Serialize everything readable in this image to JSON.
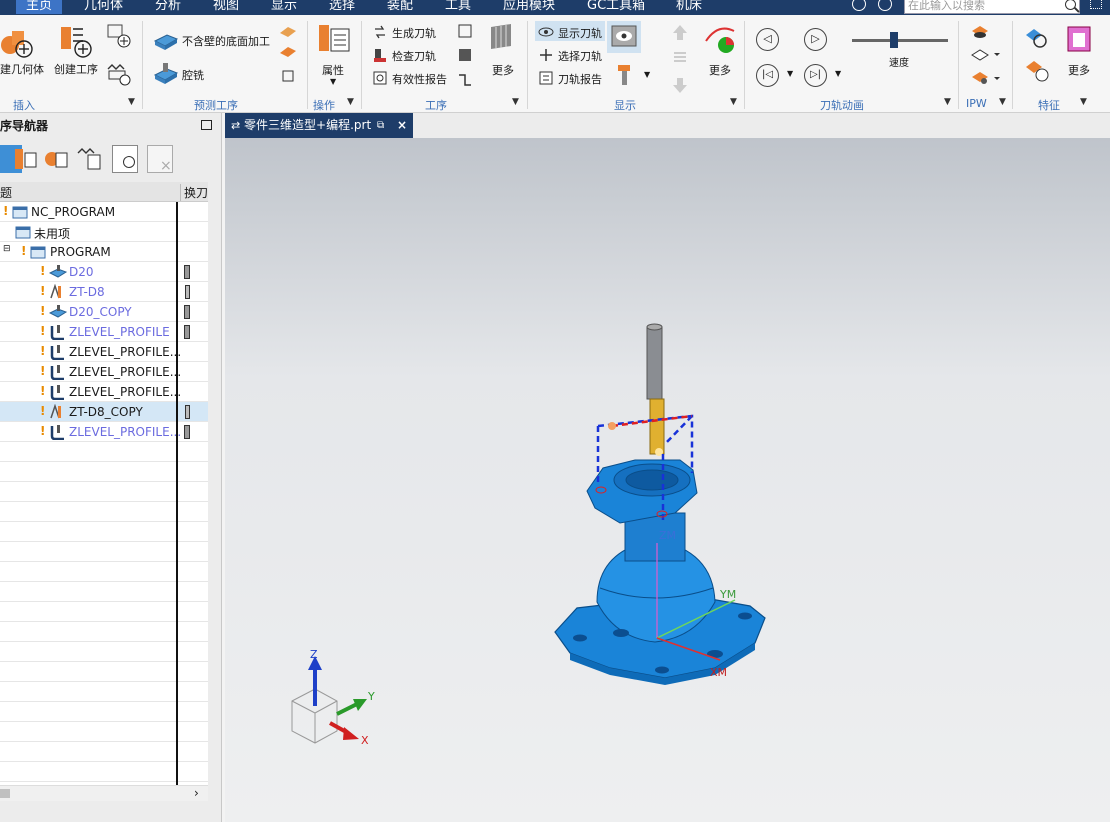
{
  "menubar": {
    "items": [
      "主页",
      "几何体",
      "分析",
      "视图",
      "显示",
      "选择",
      "装配",
      "工具",
      "应用模块",
      "GC工具箱",
      "机床"
    ],
    "search_placeholder": "在此输入以搜索"
  },
  "ribbon": {
    "insert": {
      "create_geometry": "建几何体",
      "create_operation": "创建工序",
      "label": "插入"
    },
    "predefined": {
      "floor_wall": "不含壁的底面加工",
      "cavity": "腔铣",
      "label": "预测工序"
    },
    "operation": {
      "properties": "属性",
      "label": "操作"
    },
    "process": {
      "generate": "生成刀轨",
      "verify": "检查刀轨",
      "report": "有效性报告",
      "more": "更多",
      "label": "工序"
    },
    "display": {
      "show_path": "显示刀轨",
      "select_path": "选择刀轨",
      "path_report": "刀轨报告",
      "more": "更多",
      "label": "显示"
    },
    "animation": {
      "speed": "速度",
      "label": "刀轨动画"
    },
    "ipw": {
      "label": "IPW"
    },
    "feature": {
      "more": "更多",
      "label": "特征"
    }
  },
  "navigator": {
    "title": "序导航器",
    "col_name": "题",
    "col_tool_change": "换刀",
    "rows": [
      {
        "name": "NC_PROGRAM"
      },
      {
        "name": "未用项"
      },
      {
        "name": "PROGRAM"
      },
      {
        "name": "D20"
      },
      {
        "name": "ZT-D8"
      },
      {
        "name": "D20_COPY"
      },
      {
        "name": "ZLEVEL_PROFILE"
      },
      {
        "name": "ZLEVEL_PROFILE..."
      },
      {
        "name": "ZLEVEL_PROFILE..."
      },
      {
        "name": "ZLEVEL_PROFILE..."
      },
      {
        "name": "ZT-D8_COPY"
      },
      {
        "name": "ZLEVEL_PROFILE..."
      }
    ]
  },
  "tab": {
    "title": "零件三维造型+编程.prt"
  },
  "viewport": {
    "labels": {
      "zm": "ZM",
      "ym": "YM",
      "xm": "XM",
      "z": "Z",
      "y": "Y",
      "x": "X"
    }
  },
  "colors": {
    "menubar": "#1e3d69",
    "accent": "#3d74c6",
    "part": "#1d8fe0",
    "link": "#6b6bdf"
  }
}
